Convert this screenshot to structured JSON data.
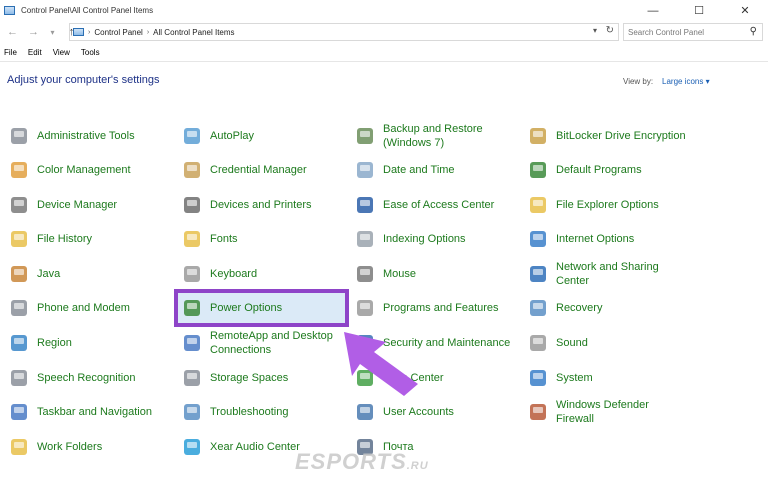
{
  "window": {
    "title": "Control Panel\\All Control Panel Items",
    "minimize": "—",
    "maximize": "☐",
    "close": "✕"
  },
  "address": {
    "crumbs": [
      "Control Panel",
      "All Control Panel Items"
    ],
    "search_placeholder": "Search Control Panel"
  },
  "menu": [
    "File",
    "Edit",
    "View",
    "Tools"
  ],
  "header": {
    "title": "Adjust your computer's settings",
    "view_by_label": "View by:",
    "view_by_value": "Large icons"
  },
  "items": [
    [
      "Administrative Tools",
      "AutoPlay",
      "Backup and Restore (Windows 7)",
      "BitLocker Drive Encryption"
    ],
    [
      "Color Management",
      "Credential Manager",
      "Date and Time",
      "Default Programs"
    ],
    [
      "Device Manager",
      "Devices and Printers",
      "Ease of Access Center",
      "File Explorer Options"
    ],
    [
      "File History",
      "Fonts",
      "Indexing Options",
      "Internet Options"
    ],
    [
      "Java",
      "Keyboard",
      "Mouse",
      "Network and Sharing Center"
    ],
    [
      "Phone and Modem",
      "Power Options",
      "Programs and Features",
      "Recovery"
    ],
    [
      "Region",
      "RemoteApp and Desktop Connections",
      "Security and Maintenance",
      "Sound"
    ],
    [
      "Speech Recognition",
      "Storage Spaces",
      "Sync Center",
      "System"
    ],
    [
      "Taskbar and Navigation",
      "Troubleshooting",
      "User Accounts",
      "Windows Defender Firewall"
    ],
    [
      "Work Folders",
      "Xear Audio Center",
      "Почта"
    ]
  ],
  "watermark": {
    "main": "ESPORTS",
    "suffix": ".RU"
  },
  "colors": {
    "link": "#1d7a1d",
    "heading": "#1e3287",
    "highlight_border": "#8e44c8",
    "arrow": "#b15ee6"
  }
}
